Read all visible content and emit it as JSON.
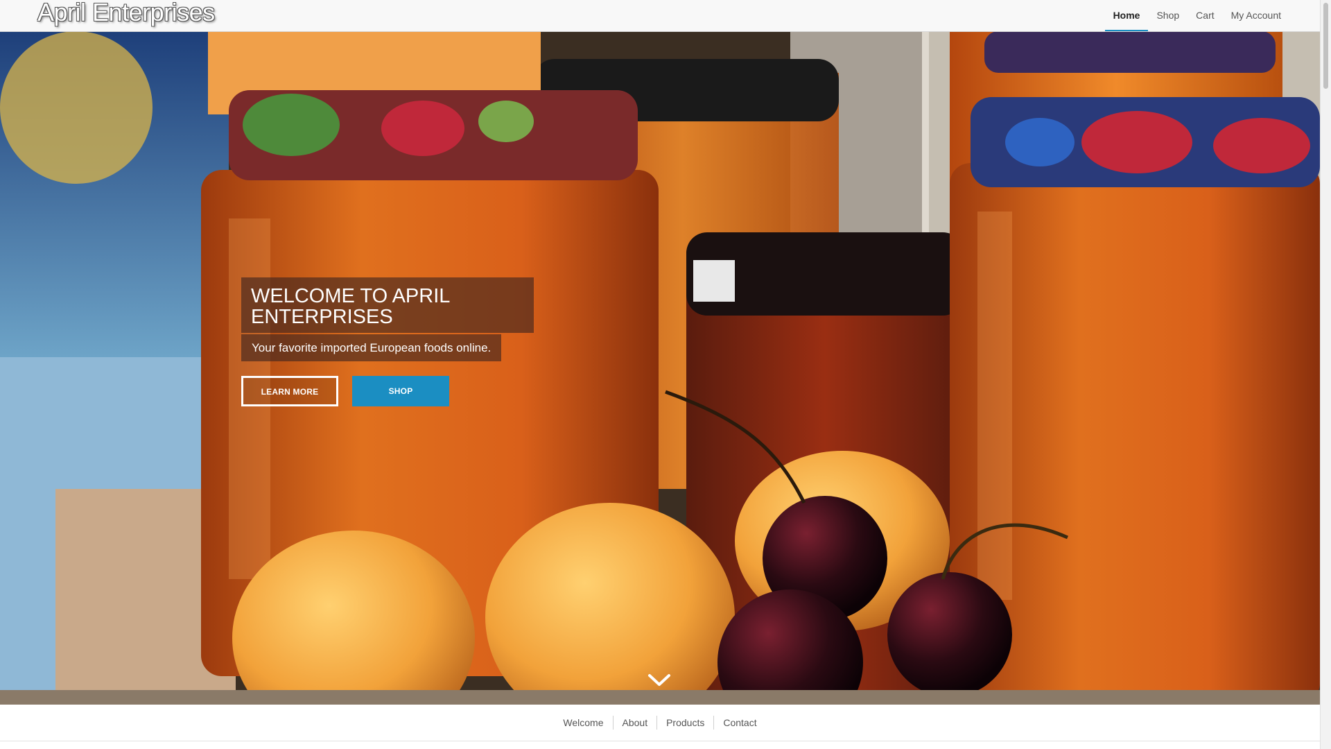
{
  "header": {
    "logo": "April Enterprises",
    "nav": [
      {
        "label": "Home",
        "active": true
      },
      {
        "label": "Shop",
        "active": false
      },
      {
        "label": "Cart",
        "active": false
      },
      {
        "label": "My Account",
        "active": false
      }
    ]
  },
  "hero": {
    "title": "WELCOME TO APRIL ENTERPRISES",
    "subtitle": "Your favorite imported European foods online.",
    "buttons": {
      "learn_more": "LEARN MORE",
      "shop": "SHOP"
    },
    "scroll_icon": "chevron-down-icon"
  },
  "section_nav": [
    "Welcome",
    "About",
    "Products",
    "Contact"
  ],
  "colors": {
    "accent": "#1b8ec2",
    "overlay": "#3c231e"
  }
}
